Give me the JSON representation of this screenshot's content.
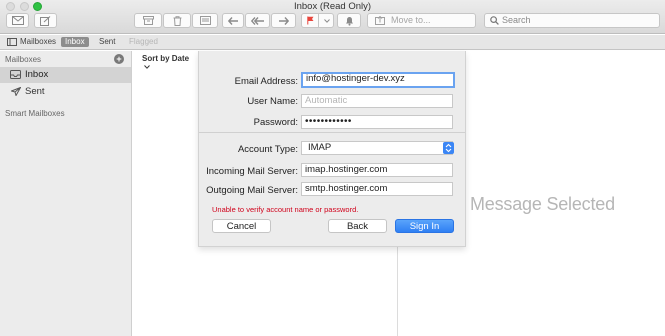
{
  "window": {
    "title": "Inbox (Read Only)"
  },
  "toolbar": {
    "move_to_label": "Move to...",
    "search_placeholder": "Search",
    "icons": [
      "get-mail-icon",
      "compose-icon",
      "archive-icon",
      "delete-icon",
      "junk-icon",
      "reply-icon",
      "reply-all-icon",
      "forward-icon",
      "flag-icon",
      "chevron-down-icon",
      "notification-bell-icon",
      "move-to-icon",
      "search-icon"
    ],
    "flag_color": "#e8453c"
  },
  "favorites": {
    "mailboxes_label": "Mailboxes",
    "inbox_label": "Inbox",
    "sent_label": "Sent",
    "flagged_label": "Flagged"
  },
  "sidebar": {
    "header": "Mailboxes",
    "items": [
      {
        "label": "Inbox",
        "icon": "inbox-icon",
        "selected": true
      },
      {
        "label": "Sent",
        "icon": "sent-icon",
        "selected": false
      }
    ],
    "smart_header": "Smart Mailboxes"
  },
  "message_list": {
    "sort_label": "Sort by Date"
  },
  "viewer": {
    "empty_text": "Message Selected"
  },
  "account_sheet": {
    "email_label": "Email Address:",
    "email_value": "info@hostinger-dev.xyz",
    "username_label": "User Name:",
    "username_placeholder": "Automatic",
    "password_label": "Password:",
    "password_value": "••••••••••••",
    "account_type_label": "Account Type:",
    "account_type_value": "IMAP",
    "incoming_label": "Incoming Mail Server:",
    "incoming_value": "imap.hostinger.com",
    "outgoing_label": "Outgoing Mail Server:",
    "outgoing_value": "smtp.hostinger.com",
    "error_text": "Unable to verify account name or password.",
    "cancel_label": "Cancel",
    "back_label": "Back",
    "signin_label": "Sign In",
    "accent": "#2f7ff3",
    "error_color": "#d0021b"
  }
}
